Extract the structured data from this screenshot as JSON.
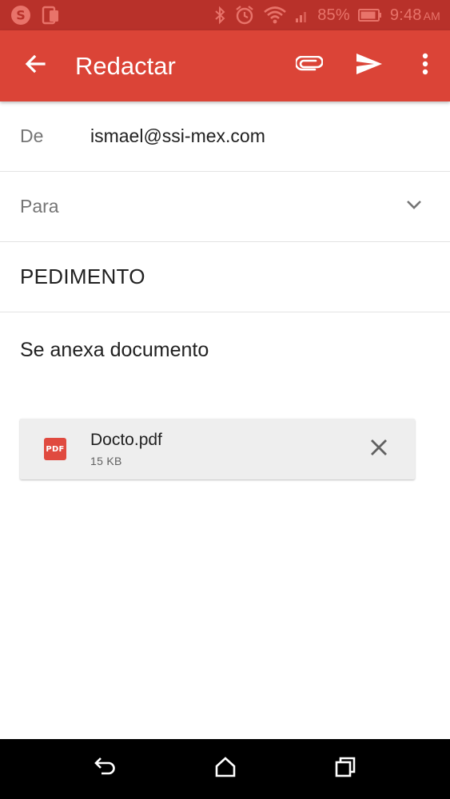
{
  "status_bar": {
    "battery_percent": "85%",
    "time": "9:48",
    "ampm": "AM",
    "icons": [
      "skype-icon",
      "sim-icon",
      "bluetooth-icon",
      "alarm-icon",
      "wifi-icon",
      "signal-icon",
      "battery-icon"
    ]
  },
  "app_bar": {
    "title": "Redactar",
    "back_icon": "arrow-left-icon",
    "actions": [
      "attach-icon",
      "send-icon",
      "more-vert-icon"
    ],
    "color": "#db4437",
    "status_color": "#b8312a"
  },
  "compose": {
    "from_label": "De",
    "from_value": "ismael@ssi-mex.com",
    "to_label": "Para",
    "subject": "PEDIMENTO",
    "body": "Se anexa documento"
  },
  "attachment": {
    "icon_text": "PDF",
    "name": "Docto.pdf",
    "size": "15 KB"
  },
  "nav_bar": {
    "buttons": [
      "back-icon",
      "home-icon",
      "recents-icon"
    ]
  }
}
